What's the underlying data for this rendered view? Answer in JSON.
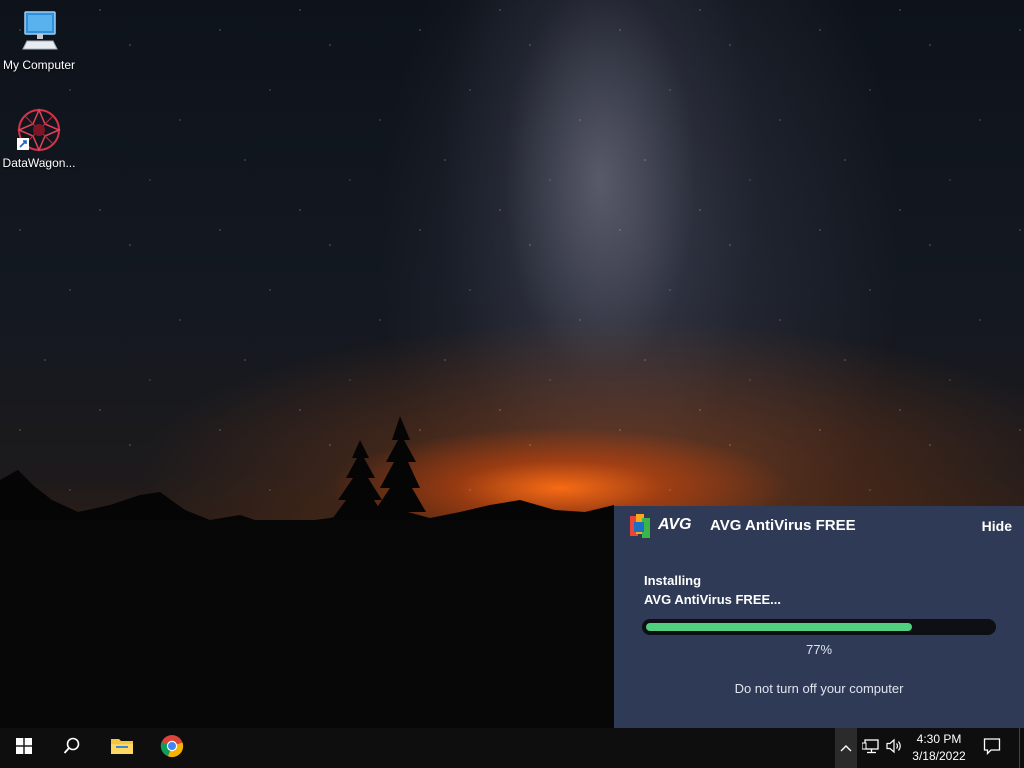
{
  "desktop": {
    "icons": [
      {
        "label": "My Computer",
        "icon": "computer-icon"
      },
      {
        "label": "DataWagon...",
        "icon": "datawagon-shortcut-icon"
      }
    ]
  },
  "avg_popup": {
    "brand": "AVG",
    "title": "AVG AntiVirus FREE",
    "hide_label": "Hide",
    "status_line1": "Installing",
    "status_line2": "AVG AntiVirus FREE...",
    "progress_fraction": 0.77,
    "progress_text": "77%",
    "note": "Do not turn off your computer",
    "colors": {
      "background": "#2f3a56",
      "progress": "#4fcf7f"
    }
  },
  "taskbar": {
    "start": "windows-start-icon",
    "search": "search-icon",
    "pinned": [
      {
        "name": "file-explorer",
        "icon": "folder-icon"
      },
      {
        "name": "chrome",
        "icon": "chrome-icon"
      }
    ],
    "tray": {
      "chevron": "chevron-up-icon",
      "network": "network-icon",
      "volume": "volume-icon",
      "time": "4:30 PM",
      "date": "3/18/2022",
      "notifications": "notification-icon"
    }
  }
}
